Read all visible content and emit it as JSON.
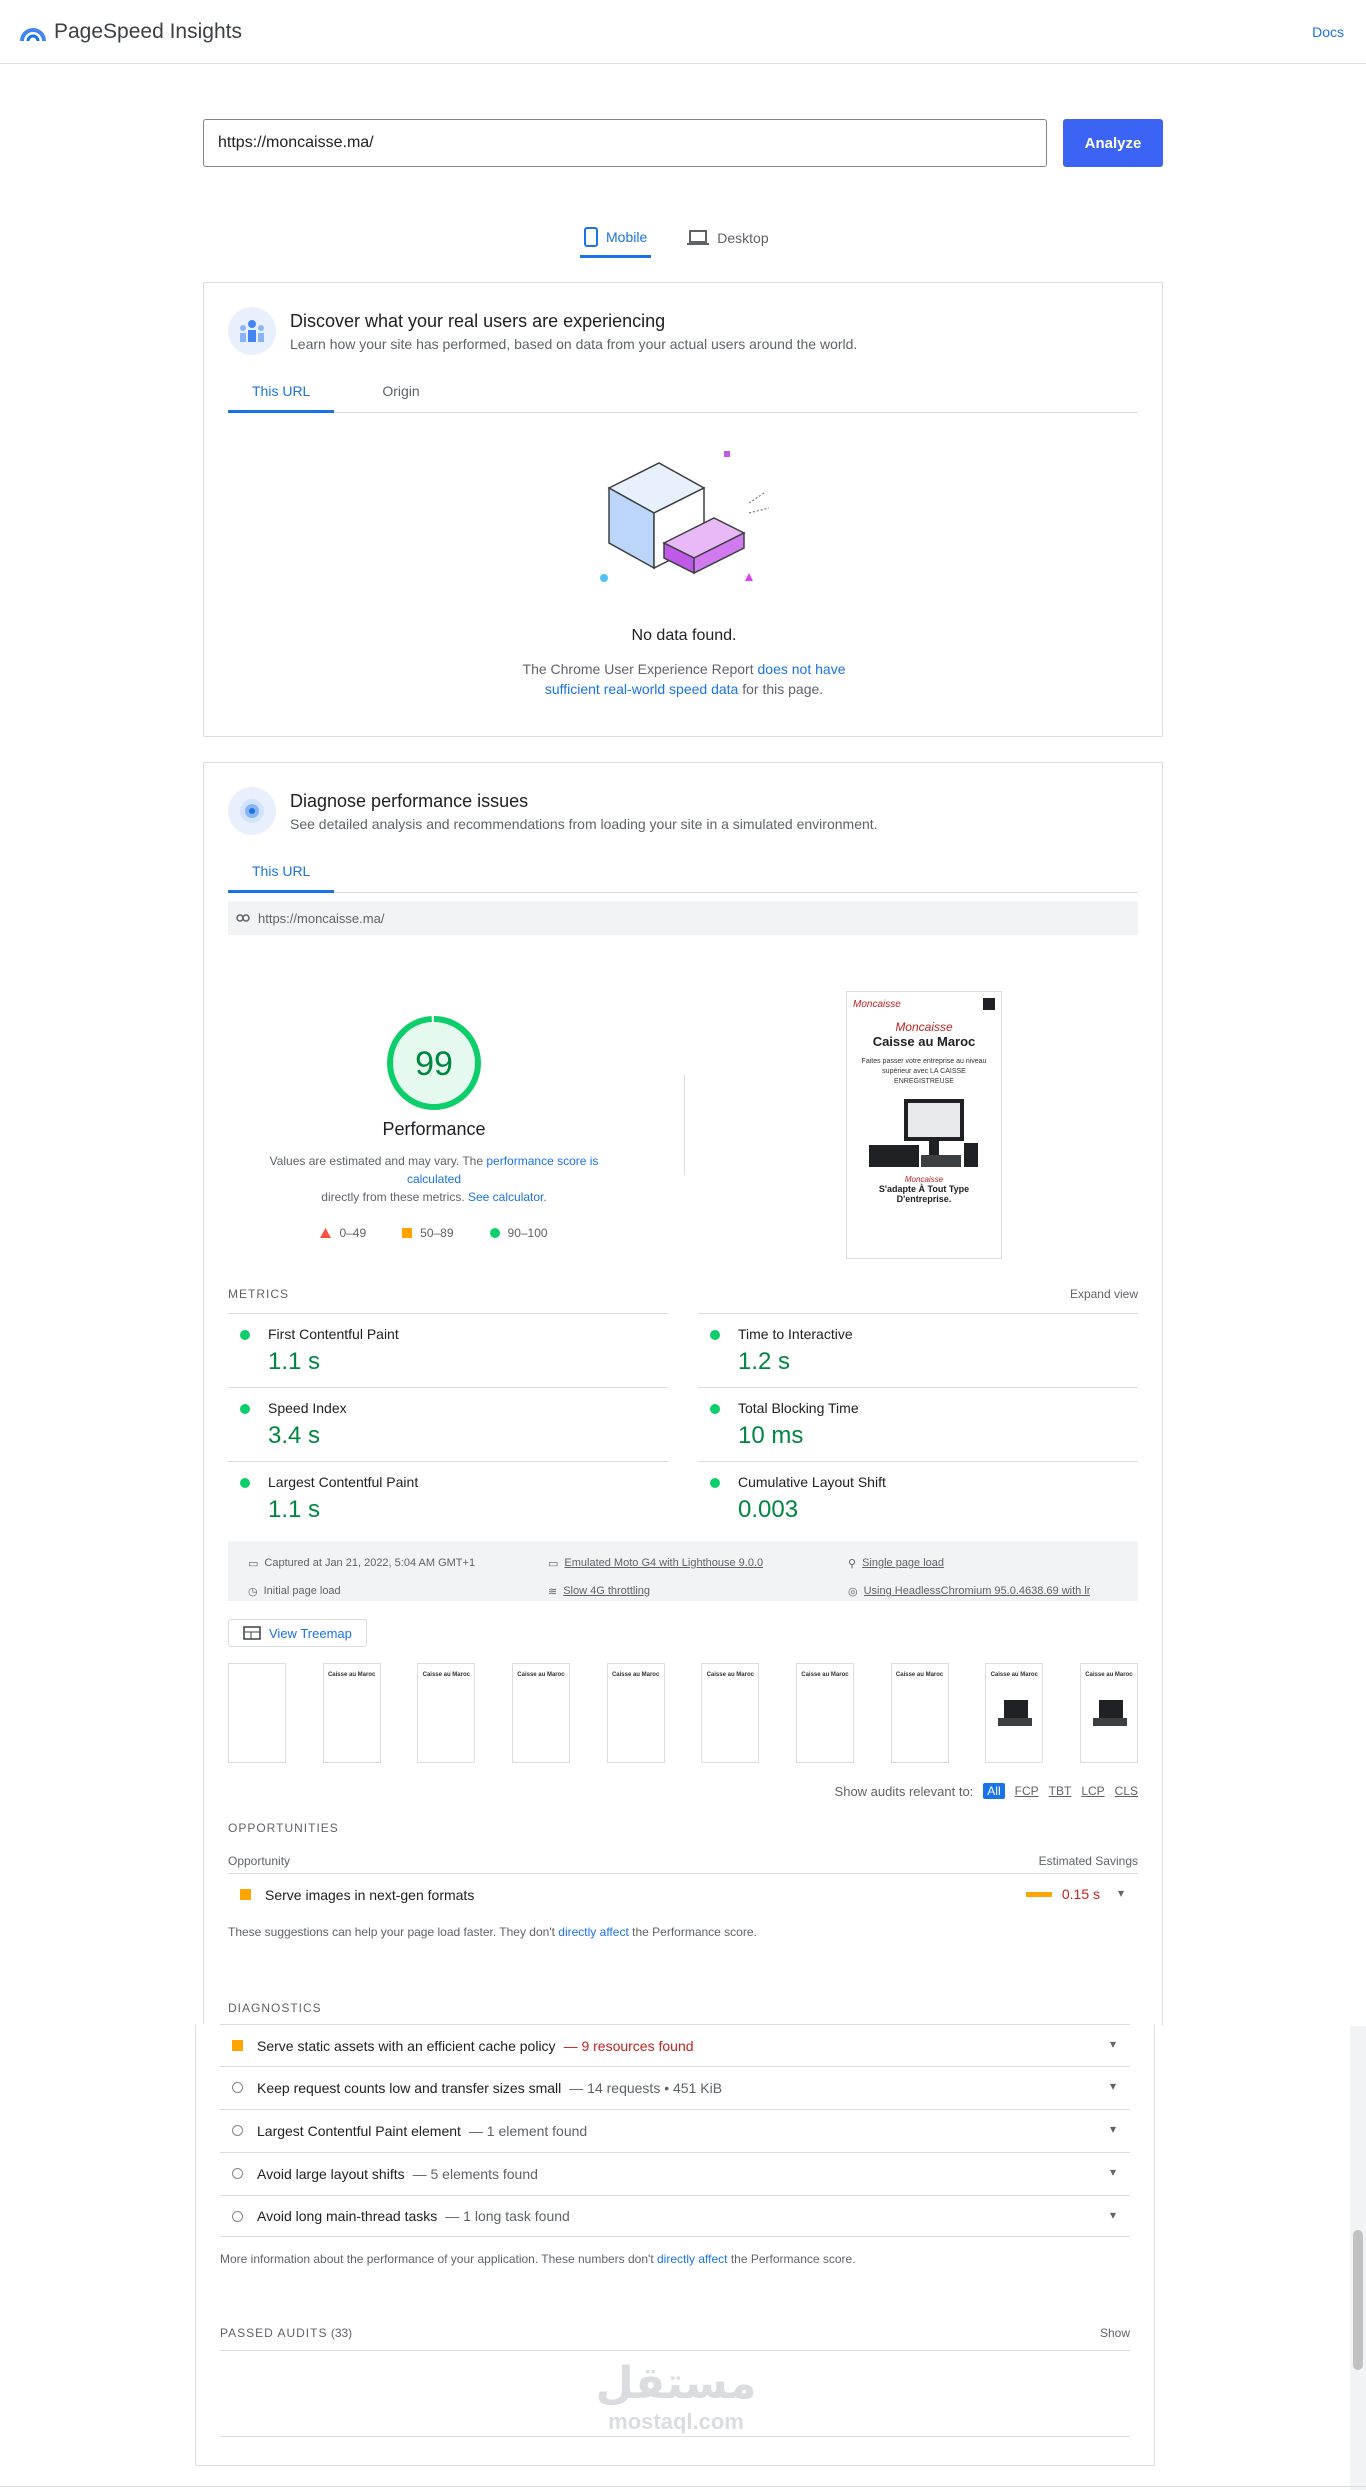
{
  "header": {
    "app_title": "PageSpeed Insights",
    "docs_label": "Docs"
  },
  "search": {
    "url_value": "https://moncaisse.ma/",
    "analyze_label": "Analyze"
  },
  "device_tabs": [
    {
      "label": "Mobile"
    },
    {
      "label": "Desktop"
    }
  ],
  "field_card": {
    "title": "Discover what your real users are experiencing",
    "subtitle": "Learn how your site has performed, based on data from your actual users around the world.",
    "tabs": [
      {
        "label": "This URL"
      },
      {
        "label": "Origin"
      }
    ],
    "nodata_title": "No data found.",
    "nodata_text_1": "The Chrome User Experience Report",
    "nodata_link_1": "does not have",
    "nodata_link_2": "sufficient real-world speed data",
    "nodata_text_2": "for this page."
  },
  "lab_card": {
    "title": "Diagnose performance issues",
    "subtitle": "See detailed analysis and recommendations from loading your site in a simulated environment.",
    "tab": "This URL",
    "tested_url": "https://moncaisse.ma/",
    "score": "99",
    "score_fraction": 0.99,
    "score_label": "Performance",
    "note_1": "Values are estimated and may vary. The",
    "note_link_1": "performance score is calculated",
    "note_2": "directly from these metrics.",
    "note_link_2": "See calculator.",
    "legend": [
      "0–49",
      "50–89",
      "90–100"
    ],
    "screenshot": {
      "logo": "Moncaisse",
      "heading": "Caisse au Maroc",
      "body": "Faites passer votre entreprise au niveau supérieur avec LA CAISSE ENREGISTREUSE",
      "footer_logo": "Moncaisse",
      "footer": "S'adapte À Tout Type D'entreprise."
    },
    "metrics_label": "METRICS",
    "expand_label": "Expand view",
    "metrics": [
      {
        "name": "First Contentful Paint",
        "value": "1.1 s"
      },
      {
        "name": "Time to Interactive",
        "value": "1.2 s"
      },
      {
        "name": "Speed Index",
        "value": "3.4 s"
      },
      {
        "name": "Total Blocking Time",
        "value": "10 ms"
      },
      {
        "name": "Largest Contentful Paint",
        "value": "1.1 s"
      },
      {
        "name": "Cumulative Layout Shift",
        "value": "0.003"
      }
    ],
    "run_info": {
      "captured": "Captured at Jan 21, 2022, 5:04 AM GMT+1",
      "device": "Emulated Moto G4 with Lighthouse 9.0.0",
      "load": "Single page load",
      "initial": "Initial page load",
      "throttling": "Slow 4G throttling",
      "browser": "Using HeadlessChromium 95.0.4638.69 with lr"
    },
    "treemap_label": "View Treemap",
    "filmstrip_heading": "Caisse au Maroc",
    "relevant_label": "Show audits relevant to:",
    "relevant_chips": [
      "All",
      "FCP",
      "TBT",
      "LCP",
      "CLS"
    ],
    "opportunities_label": "OPPORTUNITIES",
    "opp_col_left": "Opportunity",
    "opp_col_right": "Estimated Savings",
    "opportunity": {
      "title": "Serve images in next-gen formats",
      "savings": "0.15 s"
    },
    "opp_note_1": "These suggestions can help your page load faster. They don't",
    "opp_note_link": "directly affect",
    "opp_note_2": "the Performance score.",
    "diagnostics_label": "DIAGNOSTICS"
  },
  "diagnostics": [
    {
      "title": "Serve static assets with an efficient cache policy",
      "detail": "— 9 resources found"
    },
    {
      "title": "Keep request counts low and transfer sizes small",
      "detail": "— 14 requests • 451 KiB"
    },
    {
      "title": "Largest Contentful Paint element",
      "detail": "— 1 element found"
    },
    {
      "title": "Avoid large layout shifts",
      "detail": "— 5 elements found"
    },
    {
      "title": "Avoid long main-thread tasks",
      "detail": "— 1 long task found"
    }
  ],
  "diag_note_1": "More information about the performance of your application. These numbers don't",
  "diag_note_link": "directly affect",
  "diag_note_2": "the Performance score.",
  "passed": {
    "label": "PASSED AUDITS",
    "count": "(33)",
    "show_label": "Show"
  },
  "watermark": {
    "arabic": "مستقل",
    "latin": "mostaql.com"
  },
  "colors": {
    "accent": "#1a73e8",
    "button": "#3c64f4",
    "pass": "#0cce6b",
    "average": "#ffa400",
    "fail": "#ff4e42"
  }
}
